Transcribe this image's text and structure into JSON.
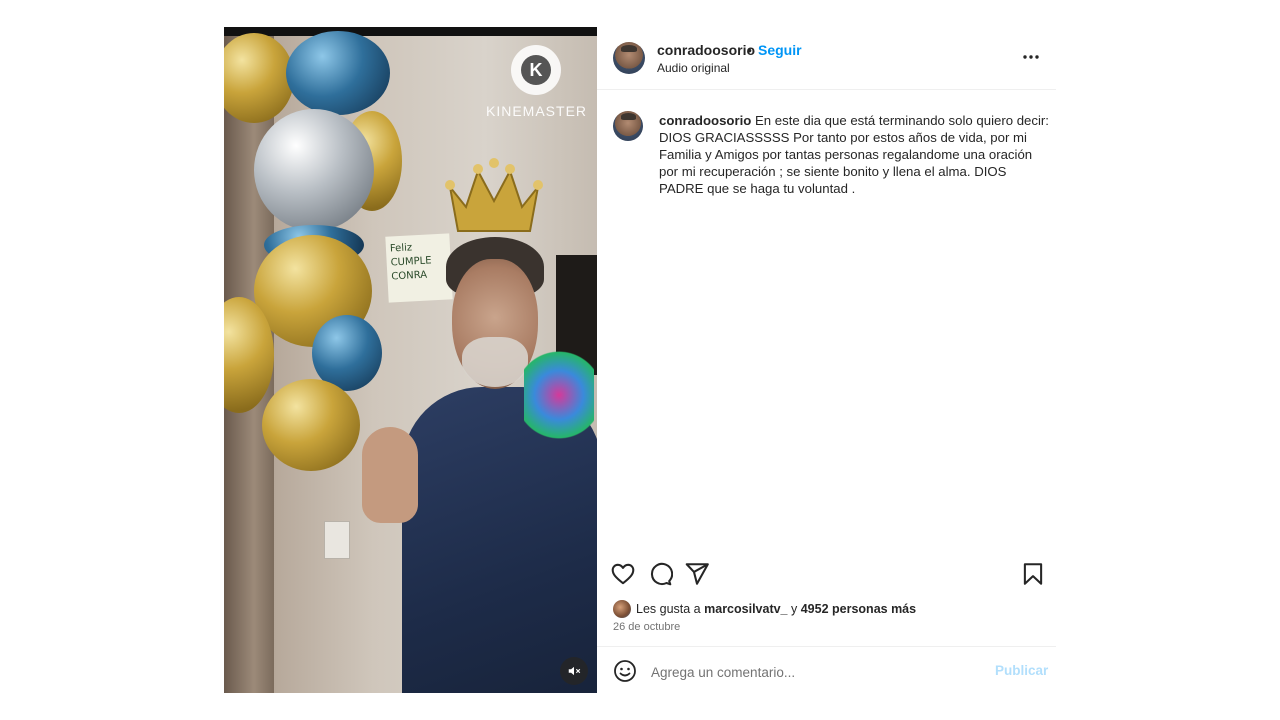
{
  "media": {
    "watermark_brand": "KINEMASTER",
    "watermark_letter": "K",
    "note_lines": [
      "Feliz",
      "CUMPLE",
      "CONRA"
    ]
  },
  "header": {
    "username": "conradoosorio",
    "separator": "•",
    "follow_label": "Seguir",
    "audio_label": "Audio original"
  },
  "caption": {
    "username": "conradoosorio",
    "text": "En este dia que está terminando solo quiero decir: DIOS GRACIASSSSS Por tanto por estos años de vida, por mi Familia y Amigos por tantas personas regalandome una oración por mi recuperación ; se siente bonito y llena el alma. DIOS PADRE que se haga tu voluntad ."
  },
  "likes": {
    "prefix": "Les gusta a",
    "user": "marcosilvatv_",
    "middle": "y",
    "count_text": "4952 personas más"
  },
  "date": "26 de octubre",
  "comment": {
    "placeholder": "Agrega un comentario...",
    "publish_label": "Publicar"
  },
  "colors": {
    "accent": "#0095f6",
    "publish_disabled": "#b2dffc",
    "text": "#262626",
    "muted": "#737373"
  },
  "icons": [
    "heart-icon",
    "comment-icon",
    "share-icon",
    "bookmark-icon",
    "more-icon",
    "emoji-icon",
    "mute-icon"
  ]
}
